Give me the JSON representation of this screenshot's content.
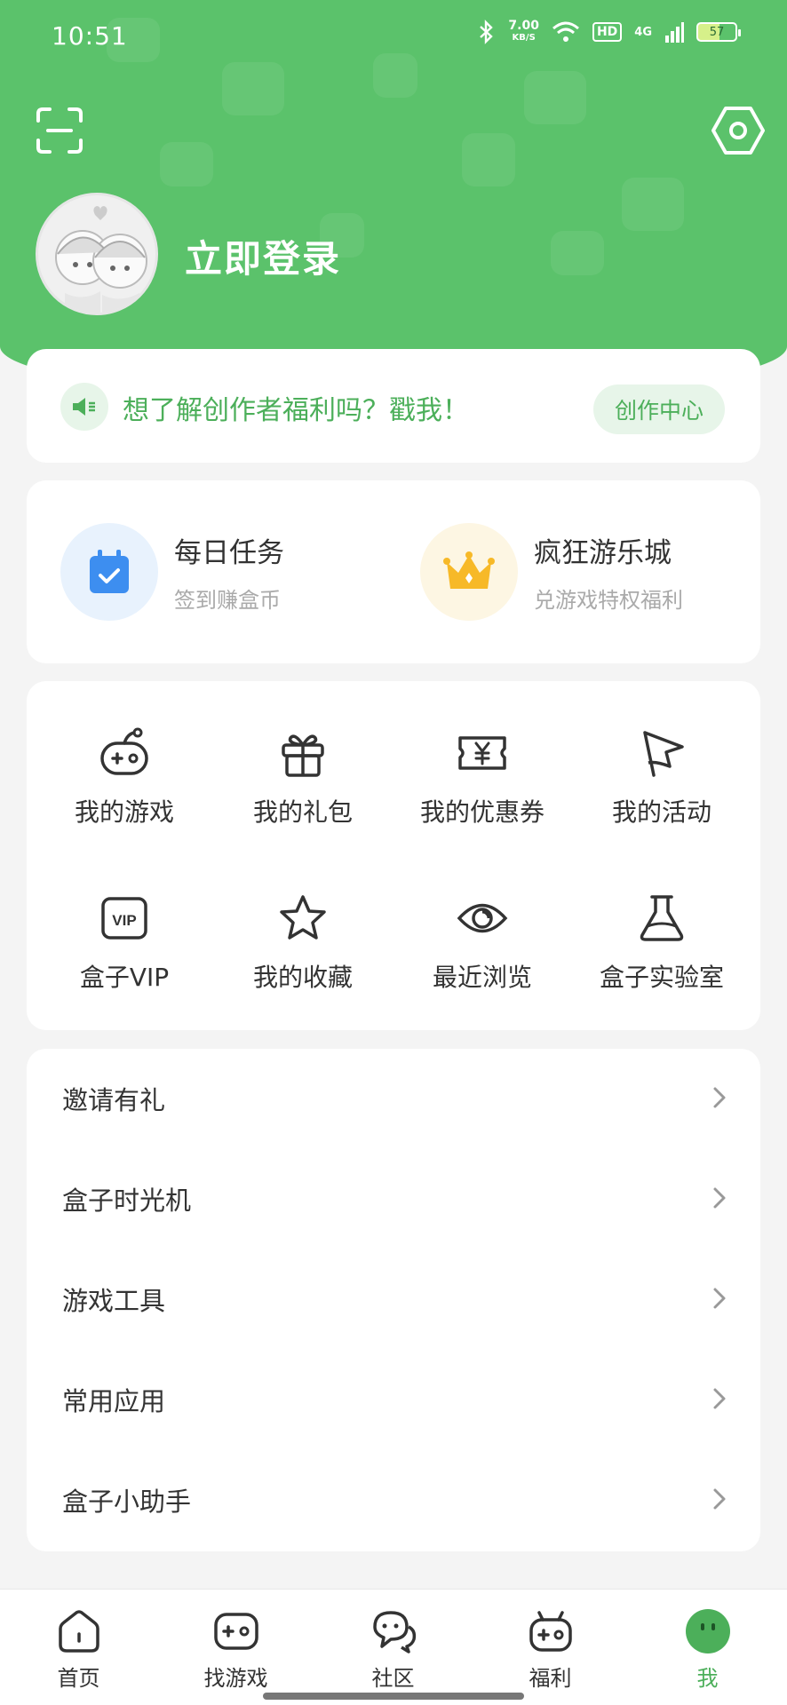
{
  "status_bar": {
    "time": "10:51",
    "speed_value": "7.00",
    "speed_unit": "KB/S",
    "hd": "HD",
    "network": "4G",
    "battery": "57"
  },
  "header": {
    "login_label": "立即登录",
    "accent_color": "#5bc26b"
  },
  "creator_banner": {
    "text": "想了解创作者福利吗？戳我！",
    "button_label": "创作中心"
  },
  "tasks": [
    {
      "title": "每日任务",
      "subtitle": "签到赚盒币",
      "icon": "calendar-check-icon"
    },
    {
      "title": "疯狂游乐城",
      "subtitle": "兑游戏特权福利",
      "icon": "crown-icon"
    }
  ],
  "grid": [
    {
      "label": "我的游戏",
      "icon": "gamepad-icon"
    },
    {
      "label": "我的礼包",
      "icon": "gift-icon"
    },
    {
      "label": "我的优惠券",
      "icon": "coupon-icon"
    },
    {
      "label": "我的活动",
      "icon": "flag-icon"
    },
    {
      "label": "盒子VIP",
      "icon": "vip-icon"
    },
    {
      "label": "我的收藏",
      "icon": "star-icon"
    },
    {
      "label": "最近浏览",
      "icon": "eye-icon"
    },
    {
      "label": "盒子实验室",
      "icon": "flask-icon"
    }
  ],
  "vip_badge": "VIP",
  "menu": [
    {
      "label": "邀请有礼"
    },
    {
      "label": "盒子时光机"
    },
    {
      "label": "游戏工具"
    },
    {
      "label": "常用应用"
    },
    {
      "label": "盒子小助手"
    }
  ],
  "tabbar": [
    {
      "label": "首页",
      "icon": "home-icon"
    },
    {
      "label": "找游戏",
      "icon": "gamepad-icon"
    },
    {
      "label": "社区",
      "icon": "chat-icon"
    },
    {
      "label": "福利",
      "icon": "gift-box-icon"
    },
    {
      "label": "我",
      "icon": "face-icon",
      "active": true
    }
  ]
}
